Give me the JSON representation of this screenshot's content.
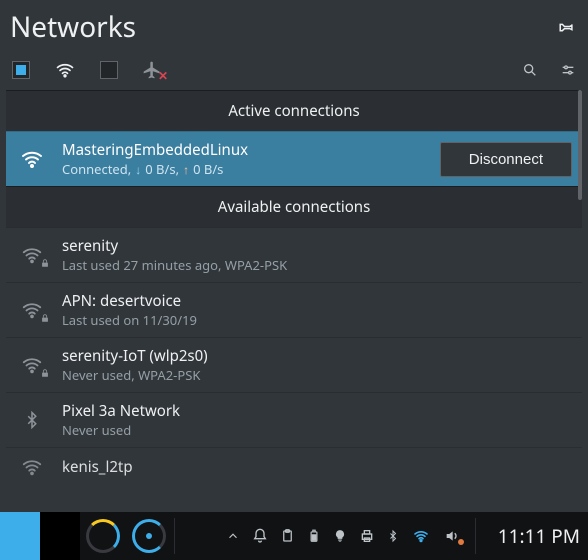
{
  "header": {
    "title": "Networks"
  },
  "toolbar": {
    "wired_enabled": true,
    "wifi_enabled": true,
    "airplane_enabled": false
  },
  "sections": {
    "active_label": "Active connections",
    "available_label": "Available connections"
  },
  "active_connection": {
    "name": "MasteringEmbeddedLinux",
    "status_prefix": "Connected,",
    "down_rate": "0 B/s,",
    "up_rate": "0 B/s",
    "disconnect_label": "Disconnect",
    "icon": "wifi-icon",
    "secured": false
  },
  "available": [
    {
      "name": "serenity",
      "sub": "Last used 27 minutes ago, WPA2-PSK",
      "icon": "wifi-icon",
      "secured": true
    },
    {
      "name": "APN: desertvoice",
      "sub": "Last used on 11/30/19",
      "icon": "wifi-icon",
      "secured": true
    },
    {
      "name": "serenity-IoT (wlp2s0)",
      "sub": "Never used, WPA2-PSK",
      "icon": "wifi-icon",
      "secured": true
    },
    {
      "name": "Pixel 3a Network",
      "sub": "Never used",
      "icon": "bluetooth-icon",
      "secured": false
    },
    {
      "name": "kenis_l2tp",
      "sub": "",
      "icon": "wifi-icon",
      "secured": false,
      "cutoff": true
    }
  ],
  "taskbar": {
    "clock": "11:11 PM"
  }
}
